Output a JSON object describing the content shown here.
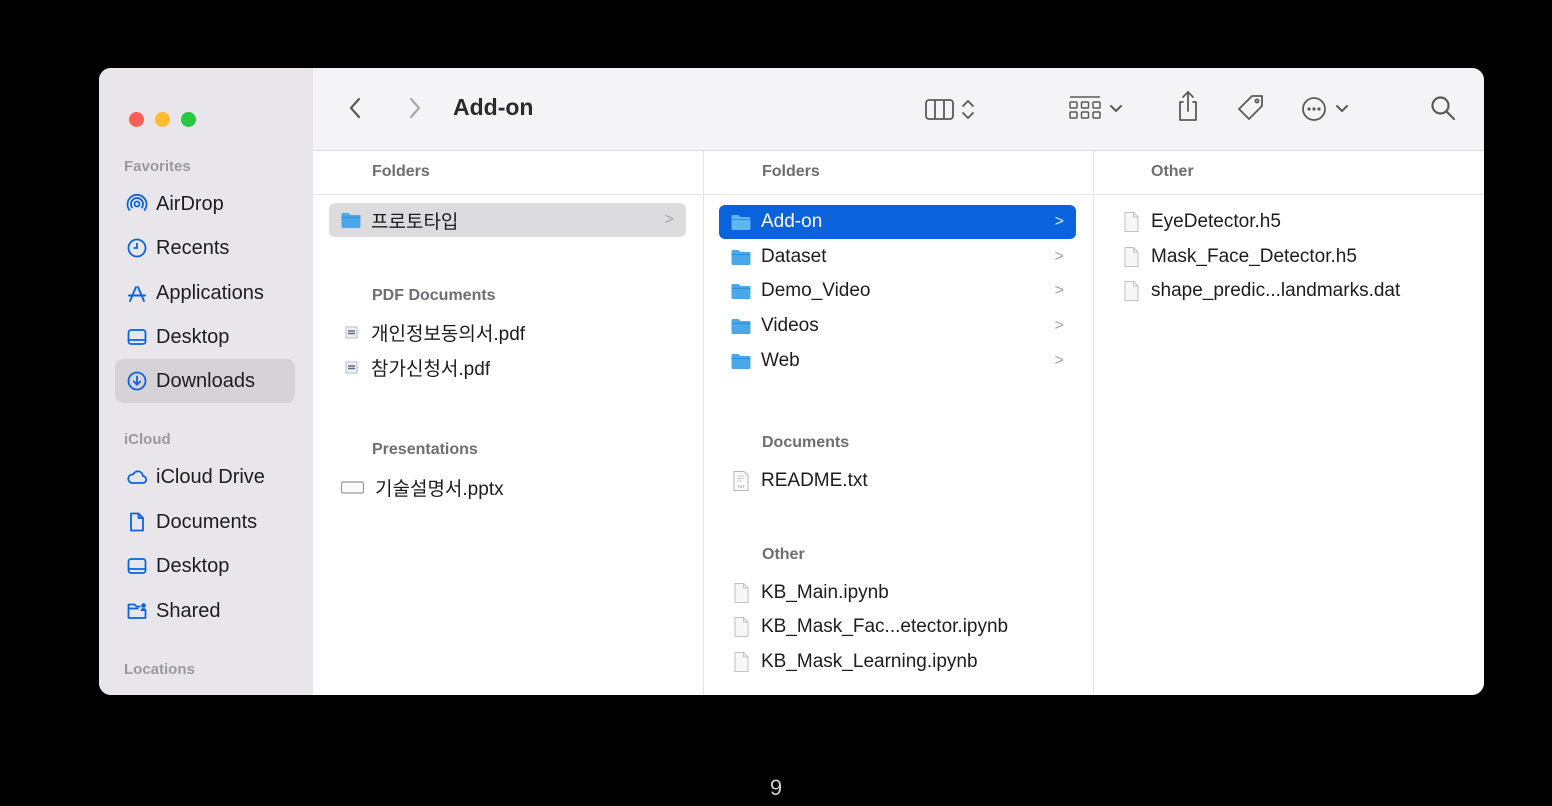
{
  "window": {
    "title": "Add-on"
  },
  "sidebar": {
    "favorites_label": "Favorites",
    "favorites": [
      {
        "label": "AirDrop",
        "icon": "airdrop-icon"
      },
      {
        "label": "Recents",
        "icon": "clock-icon"
      },
      {
        "label": "Applications",
        "icon": "applications-icon"
      },
      {
        "label": "Desktop",
        "icon": "desktop-icon"
      },
      {
        "label": "Downloads",
        "icon": "download-icon"
      }
    ],
    "icloud_label": "iCloud",
    "icloud": [
      {
        "label": "iCloud Drive",
        "icon": "cloud-icon"
      },
      {
        "label": "Documents",
        "icon": "document-icon"
      },
      {
        "label": "Desktop",
        "icon": "desktop-icon"
      },
      {
        "label": "Shared",
        "icon": "shared-folder-icon"
      }
    ],
    "locations_label": "Locations",
    "selected": "Downloads"
  },
  "columns": [
    {
      "header": "Folders",
      "folders": [
        "프로토타입"
      ],
      "pdf_label": "PDF Documents",
      "pdfs": [
        "개인정보동의서.pdf",
        "참가신청서.pdf"
      ],
      "presentations_label": "Presentations",
      "presentations": [
        "기술설명서.pptx"
      ]
    },
    {
      "header": "Folders",
      "folders": [
        "Add-on",
        "Dataset",
        "Demo_Video",
        "Videos",
        "Web"
      ],
      "documents_label": "Documents",
      "documents": [
        "README.txt"
      ],
      "other_label": "Other",
      "other": [
        "KB_Main.ipynb",
        "KB_Mask_Fac...etector.ipynb",
        "KB_Mask_Learning.ipynb"
      ]
    },
    {
      "header": "Other",
      "files": [
        "EyeDetector.h5",
        "Mask_Face_Detector.h5",
        "shape_predic...landmarks.dat"
      ]
    }
  ],
  "chevron": ">",
  "page_number": "9",
  "colors": {
    "selection_blue": "#0a63dd",
    "folder_blue": "#4aa8ea",
    "sidebar_bg": "#e8e6ea"
  }
}
